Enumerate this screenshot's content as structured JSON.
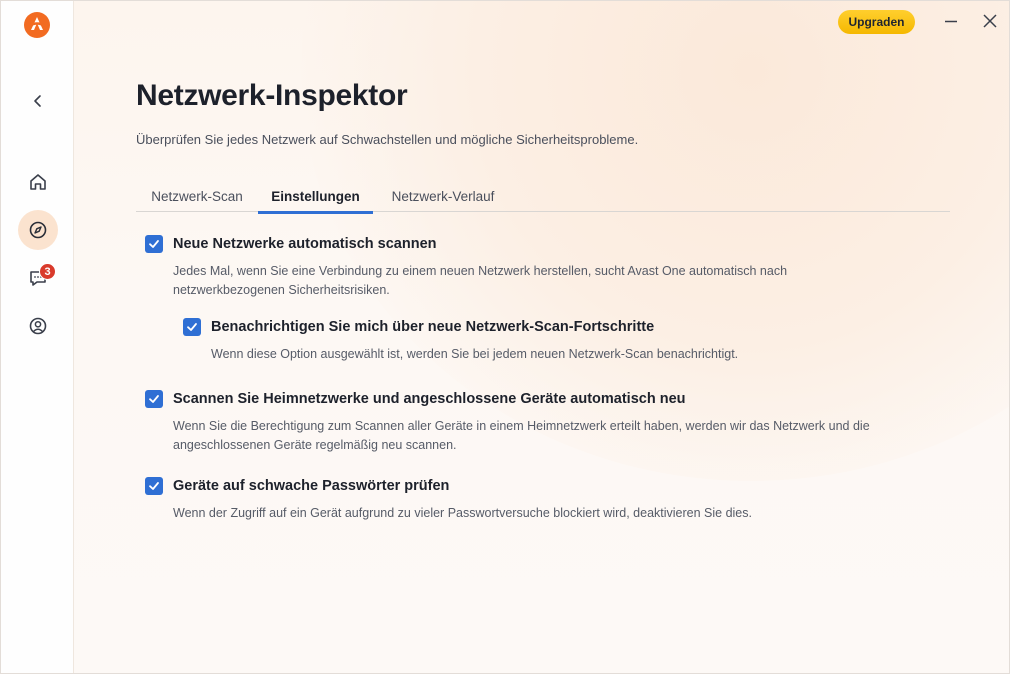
{
  "header": {
    "upgrade_label": "Upgraden"
  },
  "sidebar": {
    "notification_count": "3",
    "items": [
      {
        "name": "back",
        "icon": "chevron-left-icon"
      },
      {
        "name": "home",
        "icon": "home-icon"
      },
      {
        "name": "explore",
        "icon": "compass-icon",
        "active": true
      },
      {
        "name": "messages",
        "icon": "chat-icon"
      },
      {
        "name": "account",
        "icon": "user-icon"
      }
    ]
  },
  "main": {
    "title": "Netzwerk-Inspektor",
    "subtitle": "Überprüfen Sie jedes Netzwerk auf Schwachstellen und mögliche Sicherheitsprobleme.",
    "tabs": [
      {
        "label": "Netzwerk-Scan",
        "active": false
      },
      {
        "label": "Einstellungen",
        "active": true
      },
      {
        "label": "Netzwerk-Verlauf",
        "active": false
      }
    ],
    "options": [
      {
        "title": "Neue Netzwerke automatisch scannen",
        "desc_line1": "Jedes Mal, wenn Sie eine Verbindung zu einem neuen Netzwerk herstellen, sucht Avast One automatisch nach",
        "desc_line2": "netzwerkbezogenen Sicherheitsrisiken.",
        "checked": true
      },
      {
        "title": "Benachrichtigen Sie mich über neue Netzwerk-Scan-Fortschritte",
        "desc_line1": "Wenn diese Option ausgewählt ist, werden Sie bei jedem neuen Netzwerk-Scan benachrichtigt.",
        "checked": true
      },
      {
        "title": "Scannen Sie Heimnetzwerke und angeschlossene Geräte automatisch neu",
        "desc_line1": "Wenn Sie die Berechtigung zum Scannen aller Geräte in einem Heimnetzwerk erteilt haben, werden wir das Netzwerk und die",
        "desc_line2": "angeschlossenen Geräte regelmäßig neu scannen.",
        "checked": true
      },
      {
        "title": "Geräte auf schwache Passwörter prüfen",
        "desc_line1": "Wenn der Zugriff auf ein Gerät aufgrund zu vieler Passwortversuche blockiert wird, deaktivieren Sie dies.",
        "checked": true
      }
    ]
  },
  "colors": {
    "accent": "#2f6fd4",
    "brand": "#f26b21",
    "upgrade": "#f5b800",
    "badge": "#d93a2b"
  }
}
